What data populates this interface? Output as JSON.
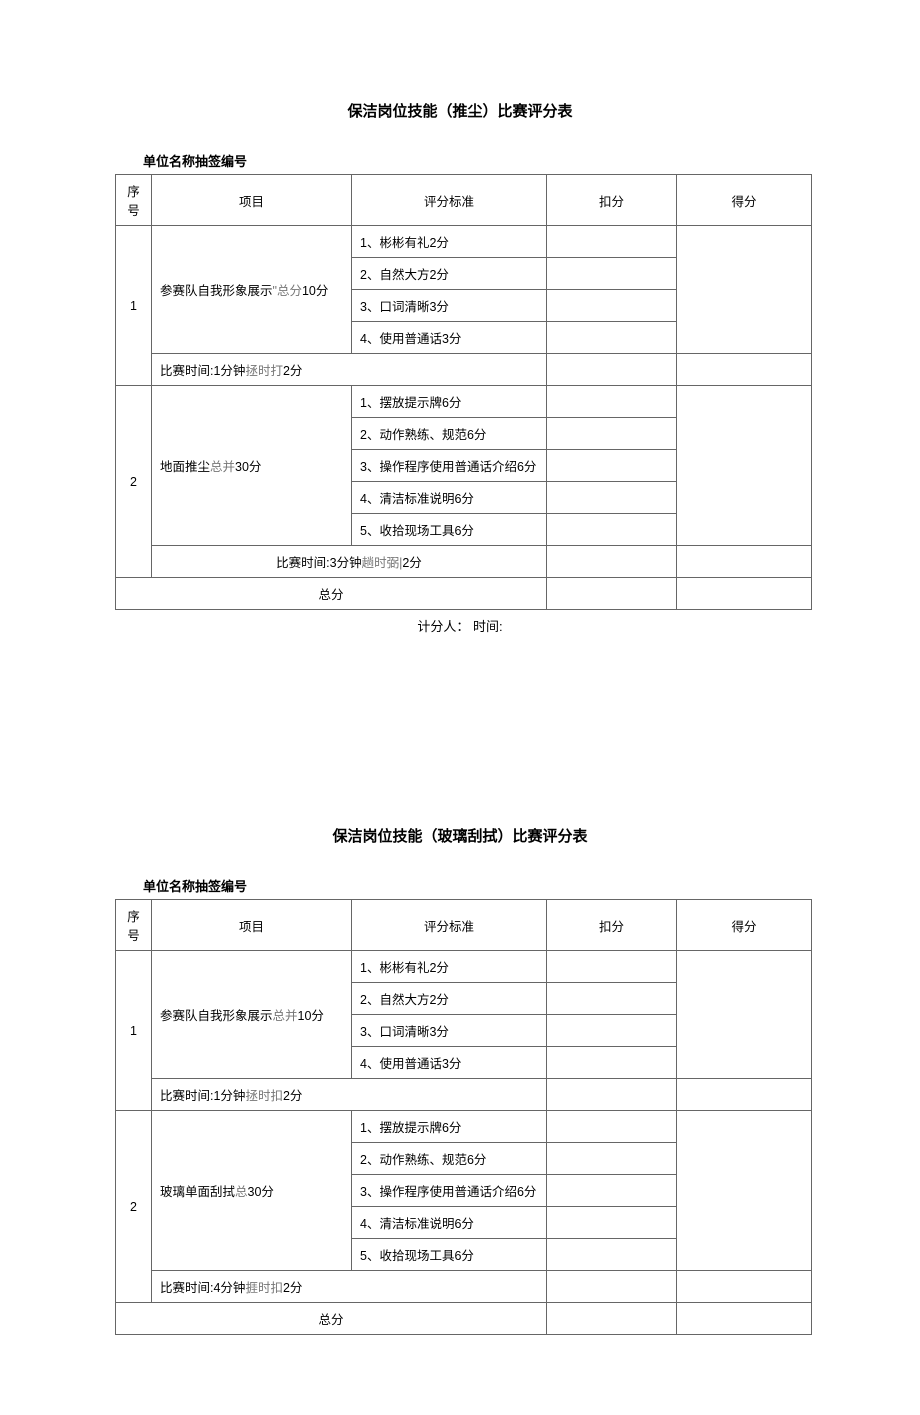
{
  "table1": {
    "title": "保洁岗位技能（推尘）比赛评分表",
    "subhead": "单位名称抽签编号",
    "headers": {
      "seq": "序号",
      "item": "项目",
      "std": "评分标准",
      "ded": "扣分",
      "score": "得分"
    },
    "r1": {
      "seq": "1",
      "item_pre": "参赛队自我形象展示",
      "item_mid": "\"总分",
      "item_suf": "10分",
      "s1": "1、彬彬有礼2分",
      "s2": "2、自然大方2分",
      "s3": "3、口词清晰3分",
      "s4": "4、使用普通话3分",
      "timing_pre": "比赛时间:1分钟",
      "timing_mid": "拯时打",
      "timing_suf": "2分"
    },
    "r2": {
      "seq": "2",
      "item_pre": "地面推尘",
      "item_mid": "总并",
      "item_suf": "30分",
      "s1": "1、摆放提示牌6分",
      "s2": "2、动作熟练、规范6分",
      "s3": "3、操作程序使用普通话介绍6分",
      "s4": "4、清洁标准说明6分",
      "s5": "5、收拾现场工具6分",
      "timing_pre": "比赛时间:3分钟",
      "timing_mid": "趟时弼|",
      "timing_suf": "2分"
    },
    "total_label": "总分",
    "footer": "计分人： 时间:"
  },
  "table2": {
    "title": "保洁岗位技能（玻璃刮拭）比赛评分表",
    "subhead": "单位名称抽签编号",
    "headers": {
      "seq": "序号",
      "item": "项目",
      "std": "评分标准",
      "ded": "扣分",
      "score": "得分"
    },
    "r1": {
      "seq": "1",
      "item_pre": "参赛队自我形象展示",
      "item_mid": "总并",
      "item_suf": "10分",
      "s1": "1、彬彬有礼2分",
      "s2": "2、自然大方2分",
      "s3": "3、口词清晰3分",
      "s4": "4、使用普通话3分",
      "timing_pre": "比赛时间:1分钟",
      "timing_mid": "拯时扣",
      "timing_suf": "2分"
    },
    "r2": {
      "seq": "2",
      "item_pre": "玻璃单面刮拭",
      "item_mid": "总",
      "item_suf": "30分",
      "s1": "1、摆放提示牌6分",
      "s2": "2、动作熟练、规范6分",
      "s3": "3、操作程序使用普通话介绍6分",
      "s4": "4、清洁标准说明6分",
      "s5": "5、收拾现场工具6分",
      "timing_pre": "比赛时间:4分钟",
      "timing_mid": "捱时扣",
      "timing_suf": "2分"
    },
    "total_label": "总分"
  }
}
